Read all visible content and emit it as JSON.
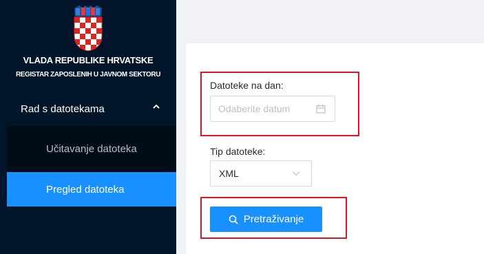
{
  "sidebar": {
    "title": "VLADA REPUBLIKE HRVATSKE",
    "subtitle": "REGISTAR ZAPOSLENIH U JAVNOM SEKTORU",
    "submenu": {
      "label": "Rad s datotekama",
      "icon": "chevron-up-icon",
      "items": [
        {
          "label": "Učitavanje datoteka",
          "active": false
        },
        {
          "label": "Pregled datoteka",
          "active": true
        }
      ]
    }
  },
  "form": {
    "date_label": "Datoteke na dan:",
    "date_placeholder": "Odaberite datum",
    "date_icon": "calendar-icon",
    "type_label": "Tip datoteke:",
    "type_value": "XML",
    "type_icon": "chevron-down-icon",
    "search_label": "Pretraživanje",
    "search_icon": "search-icon"
  },
  "colors": {
    "sidebar_bg": "#001529",
    "submenu_bg": "#000c17",
    "accent": "#1890ff",
    "highlight_box": "#e0141c",
    "content_bg": "#f0f2f5"
  }
}
